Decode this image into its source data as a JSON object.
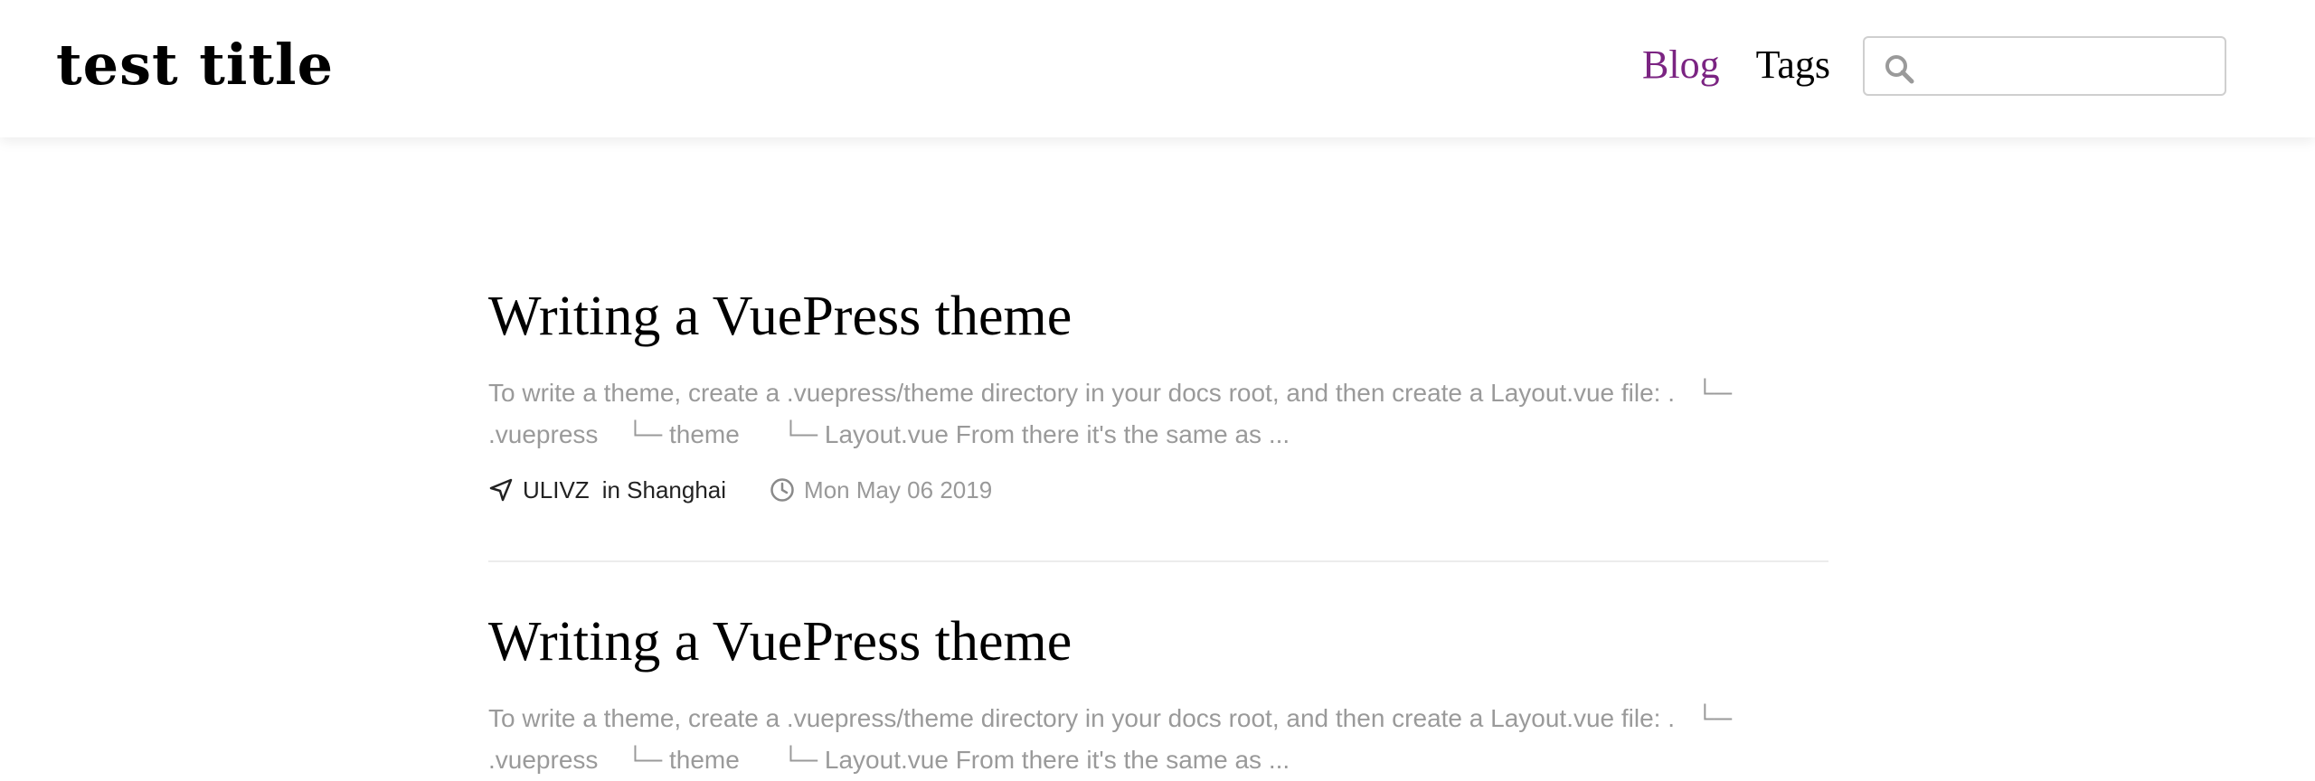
{
  "header": {
    "site_title": "test title",
    "nav": [
      {
        "label": "Blog",
        "active": true
      },
      {
        "label": "Tags",
        "active": false
      }
    ],
    "search": {
      "value": "",
      "placeholder": "",
      "icon": "search-icon"
    }
  },
  "posts": [
    {
      "title": "Writing a VuePress theme",
      "summary": "To write a theme, create a .vuepress/theme directory in your docs root, and then create a Layout.vue file: .   └─\n.vuepress    └─ theme      └─ Layout.vue From there it's the same as ...",
      "author": "ULIVZ",
      "location": "in Shanghai",
      "date": "Mon May 06 2019",
      "author_icon": "navigation-arrow-icon",
      "date_icon": "clock-icon"
    },
    {
      "title": "Writing a VuePress theme",
      "summary": "To write a theme, create a .vuepress/theme directory in your docs root, and then create a Layout.vue file: .   └─\n.vuepress    └─ theme      └─ Layout.vue From there it's the same as ..."
    }
  ],
  "colors": {
    "accent": "#7b2482",
    "summary_text": "#9a9a9a",
    "date_text": "#999999",
    "divider": "#ececec"
  }
}
